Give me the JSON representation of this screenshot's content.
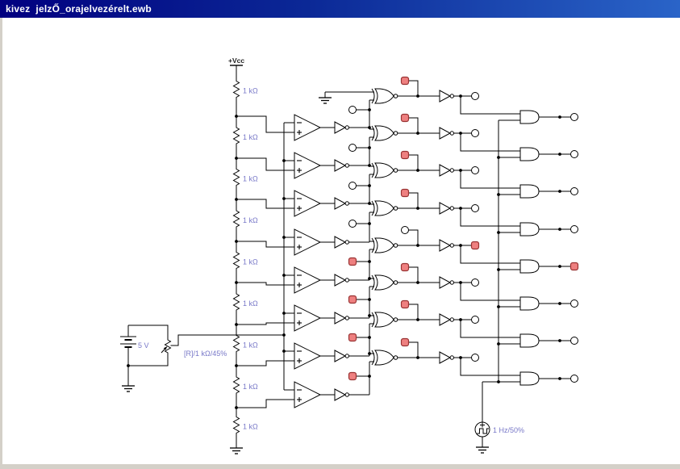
{
  "window": {
    "title": "kivez  jelzŐ_orajelvezérelt.ewb"
  },
  "colors": {
    "titlebar_left": "#010080",
    "titlebar_right": "#2a64c8",
    "title_text": "#ffffff",
    "canvas": "#ffffff",
    "frame": "#d4d0c8",
    "wire": "#000000",
    "component_label": "#7878c8",
    "vcc_label": "#222222",
    "probe_on_fill": "#ee8080",
    "probe_on_stroke": "#993333"
  },
  "components": {
    "power_label": "+Vcc",
    "ladder_resistor_label": "1 kΩ",
    "ladder_resistor_count": 9,
    "battery_label": "5 V",
    "potentiometer_label": "[R]/1 kΩ/45%",
    "clock_label": "1 Hz/50%",
    "comparator_count": 8,
    "buffer_inverter_count": 8,
    "xnor_count": 8,
    "output_inverter_count": 8,
    "and_gate_count": 8,
    "ground_count": 4
  },
  "probes": {
    "node_states": [
      "off",
      "off",
      "off",
      "off",
      "on",
      "on",
      "on",
      "on"
    ],
    "xnor_out_states": [
      "on",
      "on",
      "on",
      "on",
      "off",
      "on",
      "on",
      "on"
    ],
    "inverter_out_states": [
      "off",
      "off",
      "off",
      "off",
      "on",
      "off",
      "off",
      "off"
    ],
    "and_out_states": [
      "off",
      "off",
      "off",
      "off",
      "on",
      "off",
      "off",
      "off"
    ]
  }
}
